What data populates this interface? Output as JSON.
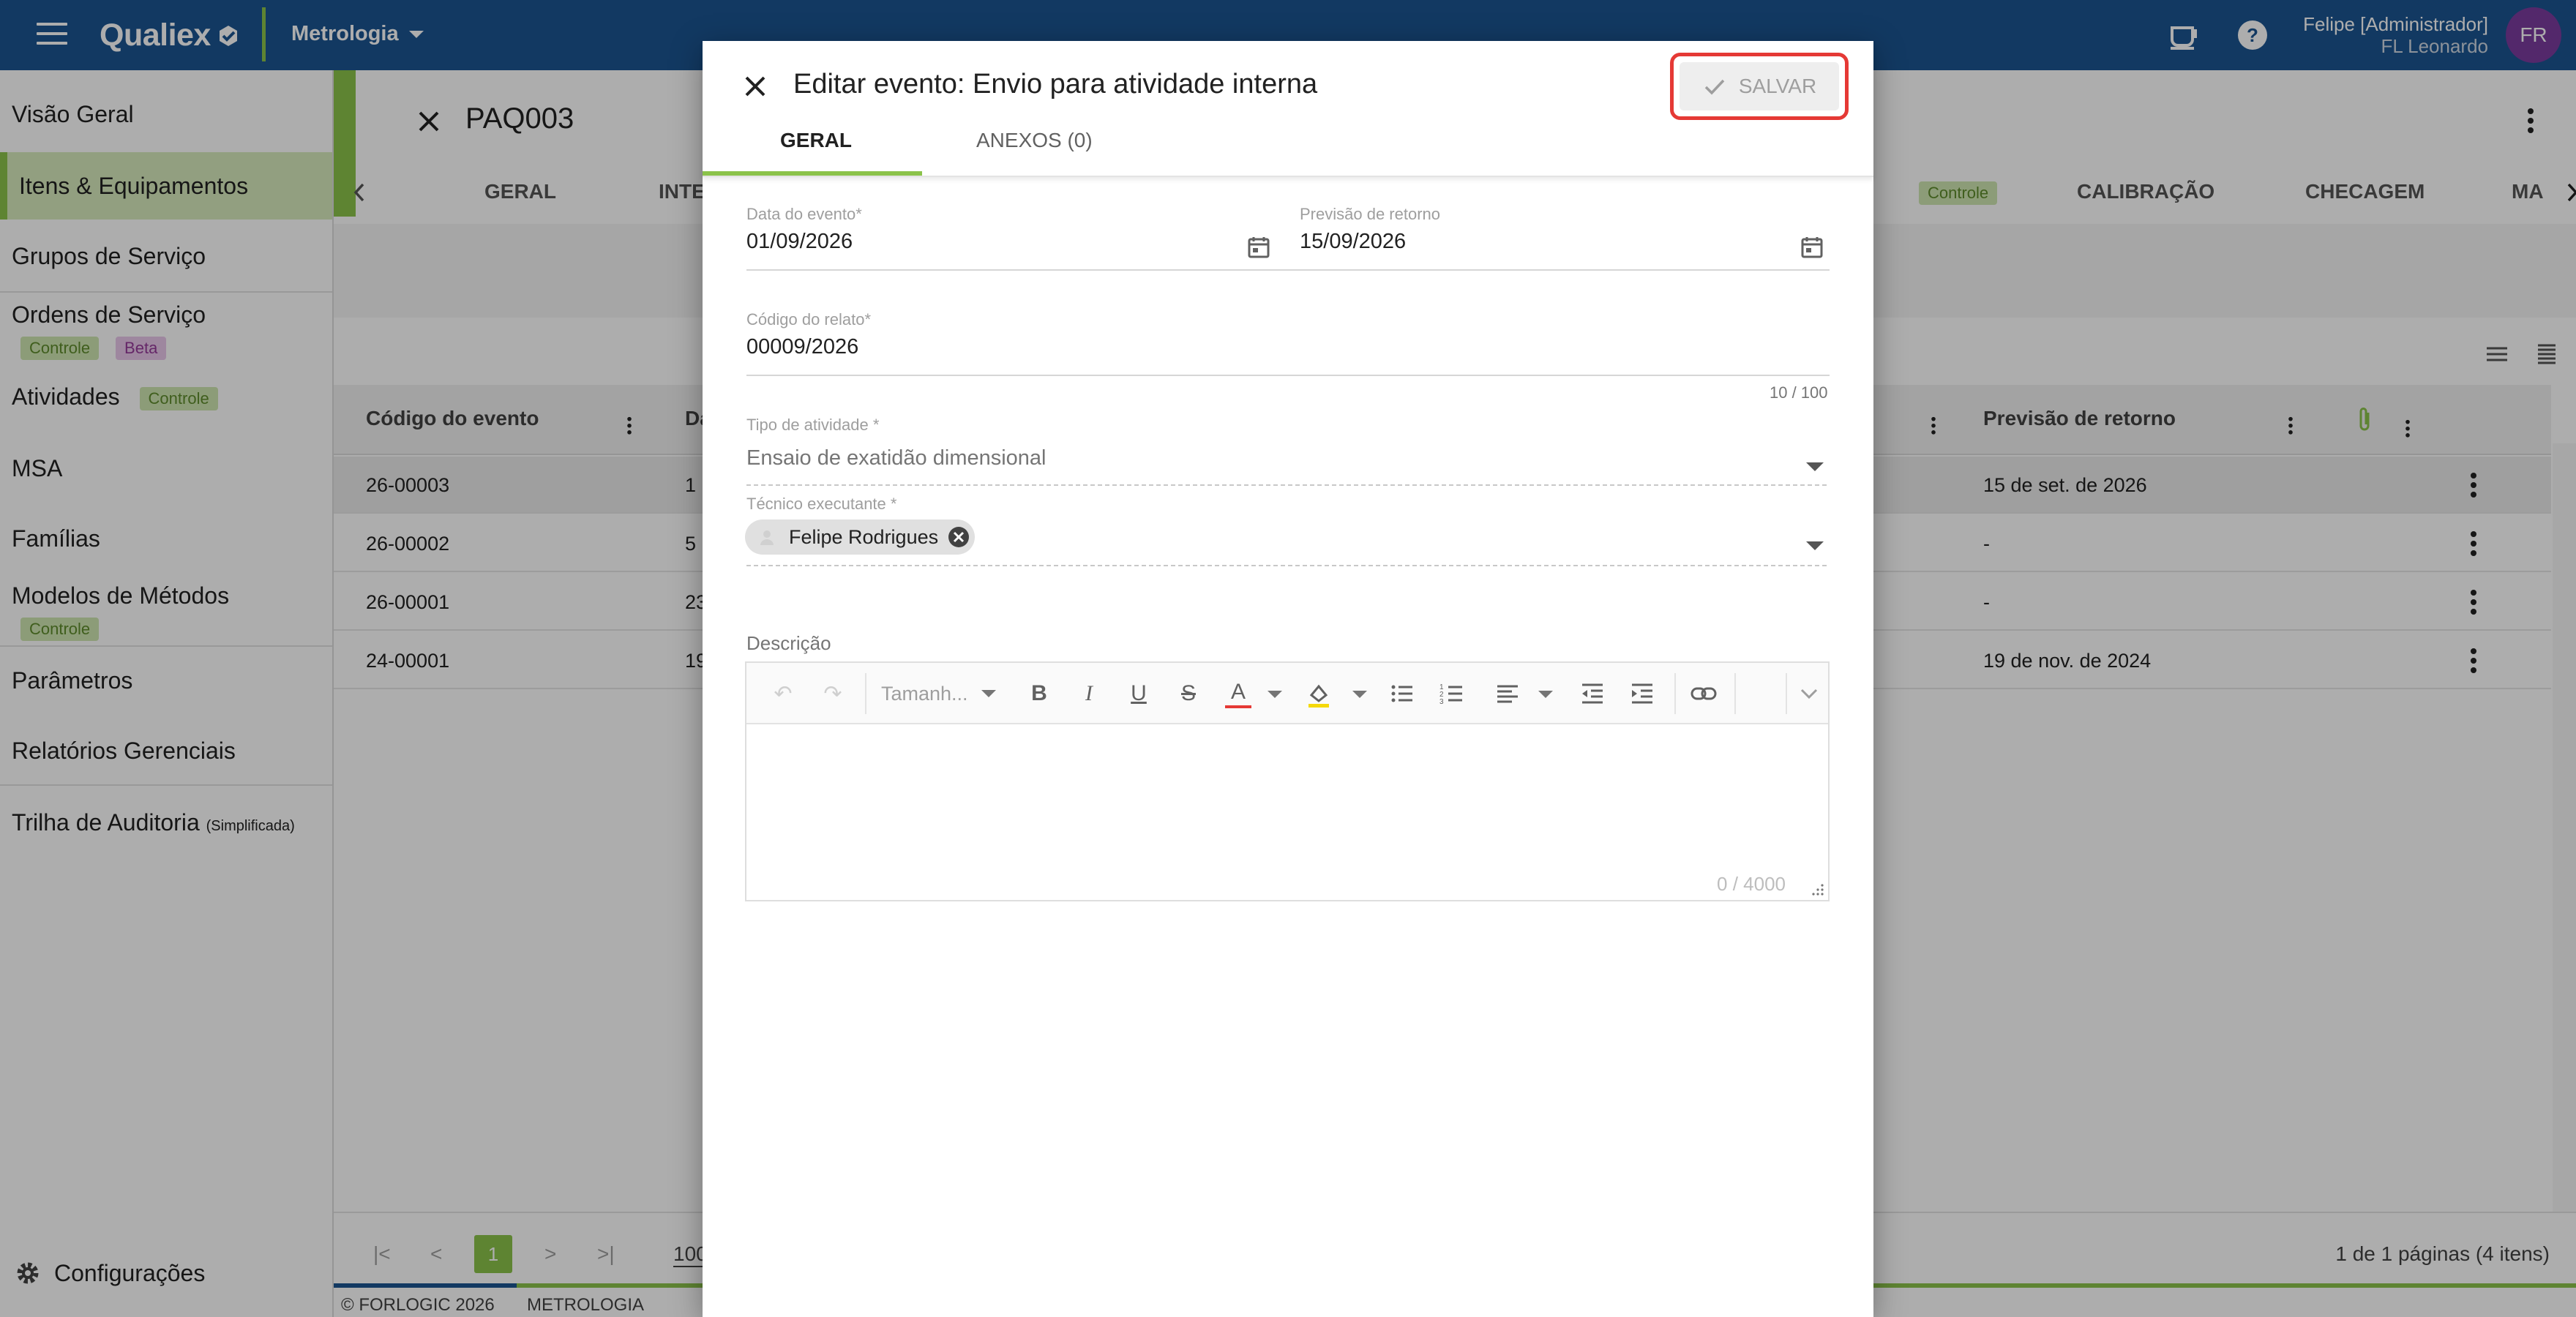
{
  "topbar": {
    "brand": "Qualiex",
    "module": "Metrologia",
    "user_name": "Felipe [Administrador]",
    "user_org": "FL Leonardo",
    "avatar_initials": "FR",
    "brand_color": "#1b5591",
    "accent_color": "#8bc34a"
  },
  "sidebar": {
    "items": [
      {
        "label": "Visão Geral"
      },
      {
        "label": "Itens & Equipamentos"
      },
      {
        "label": "Grupos de Serviço"
      },
      {
        "label": "Ordens de Serviço",
        "badges": [
          "Controle",
          "Beta"
        ]
      },
      {
        "label": "Atividades",
        "badges": [
          "Controle"
        ]
      },
      {
        "label": "MSA"
      },
      {
        "label": "Famílias"
      },
      {
        "label": "Modelos de Métodos",
        "badges": [
          "Controle"
        ]
      },
      {
        "label": "Parâmetros"
      },
      {
        "label": "Relatórios Gerenciais"
      },
      {
        "label": "Trilha de Auditoria",
        "note": "(Simplificada)"
      }
    ],
    "settings_label": "Configurações"
  },
  "item": {
    "code": "PAQ003",
    "tabs": [
      "GERAL",
      "INTERV",
      "Controle",
      "CALIBRAÇÃO",
      "CHECAGEM",
      "MA"
    ]
  },
  "table": {
    "columns": [
      "Código do evento",
      "Da",
      "Previsão de retorno"
    ],
    "rows": [
      {
        "code": "26-00003",
        "date": "1",
        "return": "15 de set. de 2026"
      },
      {
        "code": "26-00002",
        "date": "5",
        "return": "-"
      },
      {
        "code": "26-00001",
        "date": "23",
        "return": "-"
      },
      {
        "code": "24-00001",
        "date": "19",
        "return": "19 de nov. de 2024"
      }
    ]
  },
  "pager": {
    "current_page": "1",
    "page_size": "100",
    "info": "1 de 1 páginas (4 itens)"
  },
  "footer": {
    "copyright": "© FORLOGIC 2026",
    "module": "METROLOGIA"
  },
  "dialog": {
    "title": "Editar evento: Envio para atividade interna",
    "save_label": "SALVAR",
    "tabs": [
      "GERAL",
      "ANEXOS (0)"
    ],
    "fields": {
      "event_date": {
        "label": "Data do evento*",
        "value": "01/09/2026"
      },
      "return_date": {
        "label": "Previsão de retorno",
        "value": "15/09/2026"
      },
      "report_code": {
        "label": "Código do relato*",
        "value": "00009/2026",
        "counter": "10 / 100"
      },
      "activity_type": {
        "label": "Tipo de atividade *",
        "placeholder": "Ensaio de exatidão dimensional"
      },
      "technician": {
        "label": "Técnico executante *",
        "chip": "Felipe Rodrigues"
      },
      "description": {
        "label": "Descrição",
        "counter": "0 / 4000",
        "font_size_placeholder": "Tamanh..."
      }
    }
  }
}
